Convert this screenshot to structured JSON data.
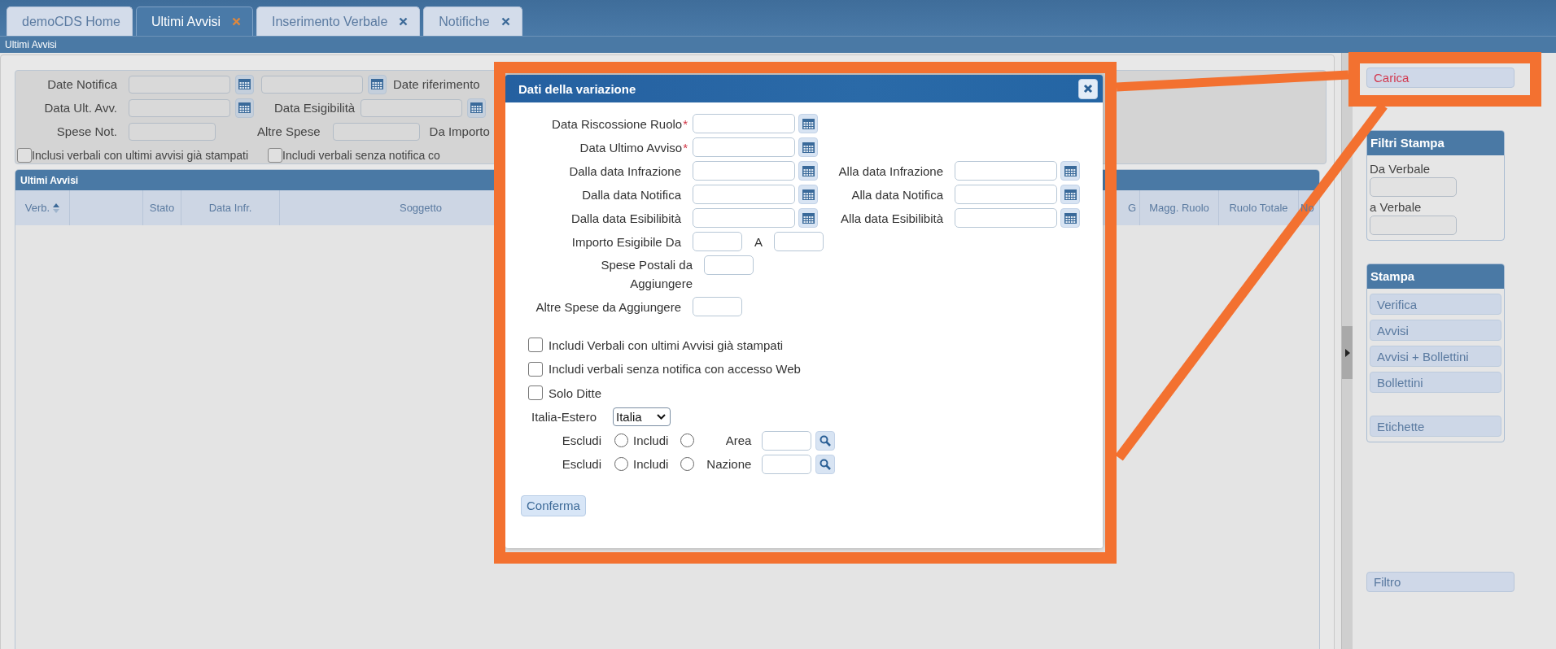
{
  "tabs": [
    {
      "label": "demoCDS Home",
      "selected": false,
      "closable": false
    },
    {
      "label": "Ultimi Avvisi",
      "selected": true,
      "closable": true
    },
    {
      "label": "Inserimento Verbale",
      "selected": false,
      "closable": true
    },
    {
      "label": "Notifiche",
      "selected": false,
      "closable": true
    }
  ],
  "breadcrumb": "Ultimi Avvisi",
  "filter_rows": [
    [
      {
        "kind": "label",
        "text": "Date Notifica"
      },
      {
        "kind": "date"
      },
      {
        "kind": "date"
      },
      {
        "kind": "label",
        "text": "Date riferimento"
      }
    ],
    [
      {
        "kind": "label",
        "text": "Data Ult. Avv."
      },
      {
        "kind": "date"
      },
      {
        "kind": "label",
        "text": "Data Esigibilità"
      },
      {
        "kind": "date"
      }
    ],
    [
      {
        "kind": "label",
        "text": "Spese Not."
      },
      {
        "kind": "field"
      },
      {
        "kind": "label",
        "text": "Altre Spese"
      },
      {
        "kind": "field"
      },
      {
        "kind": "label",
        "text": "Da Importo"
      }
    ],
    [
      {
        "kind": "checkbox",
        "label": "Inclusi verbali con ultimi avvisi già stampati",
        "checked": false
      },
      {
        "kind": "checkbox",
        "label": "Includi verbali senza notifica co",
        "checked": false
      }
    ]
  ],
  "table": {
    "title": "Ultimi Avvisi",
    "columns_left": [
      {
        "label": "Verb.",
        "sort_ascending": true
      },
      {
        "label": "Stato"
      },
      {
        "label": "Data Infr."
      },
      {
        "label": "Soggetto"
      }
    ],
    "columns_right": [
      {
        "label": "G"
      },
      {
        "label": "Magg. Ruolo"
      },
      {
        "label": "Ruolo Totale"
      },
      {
        "label": "No"
      }
    ]
  },
  "dialog": {
    "title": "Dati della variazione",
    "date_rows": [
      {
        "label": "Data Riscossione Ruolo",
        "required_mark": "*"
      },
      {
        "label": "Data Ultimo Avviso",
        "required_mark": "*"
      },
      {
        "label": "Dalla data Infrazione",
        "to_label": "Alla data Infrazione"
      },
      {
        "label": "Dalla data Notifica",
        "to_label": "Alla data Notifica"
      },
      {
        "label": "Dalla data Esibilibità",
        "to_label": "Alla data Esibilibità"
      }
    ],
    "amount_row": {
      "label": "Importo Esigibile Da",
      "to_label": "A"
    },
    "postal_fees": {
      "label": "Spese Postali da Aggiungere"
    },
    "other_fees": {
      "label": "Altre Spese da Aggiungere"
    },
    "checkboxes": [
      {
        "label": "Includi Verbali con ultimi Avvisi già stampati",
        "checked": false
      },
      {
        "label": "Includi verbali senza notifica con accesso Web",
        "checked": false
      },
      {
        "label": "Solo Ditte",
        "checked": false
      }
    ],
    "region": {
      "label": "Italia-Estero",
      "value": "Italia"
    },
    "scope_rows": [
      {
        "options": [
          {
            "label": "Escludi",
            "selected": false
          },
          {
            "label": "Includi",
            "selected": false
          }
        ],
        "field_label": "Area"
      },
      {
        "options": [
          {
            "label": "Escludi",
            "selected": false
          },
          {
            "label": "Includi",
            "selected": false
          }
        ],
        "field_label": "Nazione"
      }
    ],
    "confirm": "Conferma"
  },
  "sidebar": {
    "load": "Carica",
    "print_filters": {
      "title": "Filtri Stampa",
      "fields": [
        "Da Verbale",
        "a Verbale"
      ]
    },
    "print": {
      "title": "Stampa",
      "buttons": [
        "Verifica",
        "Avvisi",
        "Avvisi + Bollettini",
        "Bollettini",
        "Etichette"
      ]
    },
    "filter": "Filtro"
  }
}
